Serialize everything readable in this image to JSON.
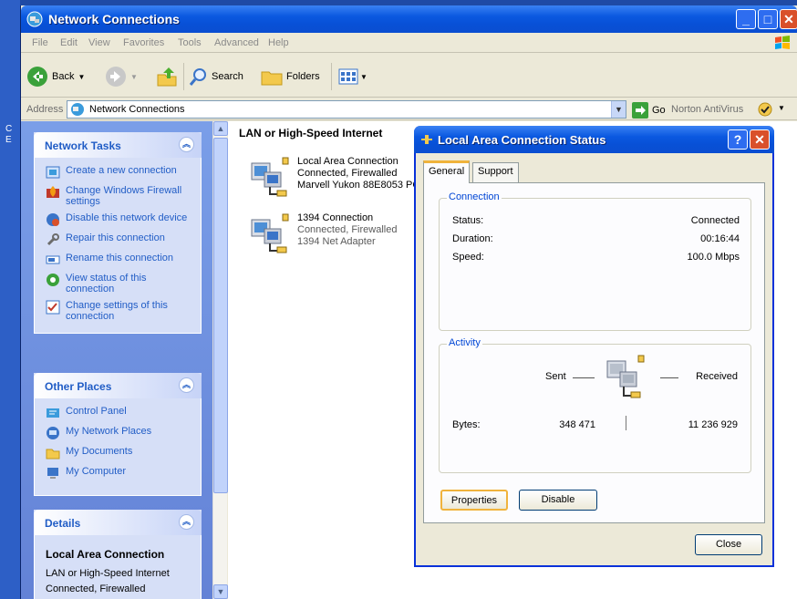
{
  "window": {
    "title": "Network Connections"
  },
  "menu": [
    "File",
    "Edit",
    "View",
    "Favorites",
    "Tools",
    "Advanced",
    "Help"
  ],
  "toolbar": {
    "back": "Back",
    "search": "Search",
    "folders": "Folders"
  },
  "address": {
    "label": "Address",
    "value": "Network Connections",
    "go": "Go",
    "norton": "Norton AntiVirus"
  },
  "tasks": {
    "network_tasks": {
      "title": "Network Tasks",
      "items": [
        "Create a new connection",
        "Change Windows Firewall settings",
        "Disable this network device",
        "Repair this connection",
        "Rename this connection",
        "View status of this connection",
        "Change settings of this connection"
      ]
    },
    "other_places": {
      "title": "Other Places",
      "items": [
        "Control Panel",
        "My Network Places",
        "My Documents",
        "My Computer"
      ]
    },
    "details": {
      "title": "Details",
      "name": "Local Area Connection",
      "type": "LAN or High-Speed Internet",
      "status": "Connected, Firewalled"
    }
  },
  "content": {
    "group_header": "LAN or High-Speed Internet",
    "connections": [
      {
        "name": "Local Area Connection",
        "status": "Connected, Firewalled",
        "device": "Marvell Yukon 88E8053 PC"
      },
      {
        "name": "1394 Connection",
        "status": "Connected, Firewalled",
        "device": "1394 Net Adapter"
      }
    ]
  },
  "dialog": {
    "title": "Local Area Connection Status",
    "tabs": [
      "General",
      "Support"
    ],
    "connection": {
      "legend": "Connection",
      "status_label": "Status:",
      "status_value": "Connected",
      "duration_label": "Duration:",
      "duration_value": "00:16:44",
      "speed_label": "Speed:",
      "speed_value": "100.0 Mbps"
    },
    "activity": {
      "legend": "Activity",
      "sent_label": "Sent",
      "received_label": "Received",
      "bytes_label": "Bytes:",
      "bytes_sent": "348 471",
      "bytes_received": "11 236 929"
    },
    "buttons": {
      "properties": "Properties",
      "disable": "Disable",
      "close": "Close"
    }
  },
  "colors": {
    "xp_blue": "#0a58e0",
    "task_link": "#215dc6",
    "legend": "#0046d5",
    "close_red": "#d9502a"
  }
}
